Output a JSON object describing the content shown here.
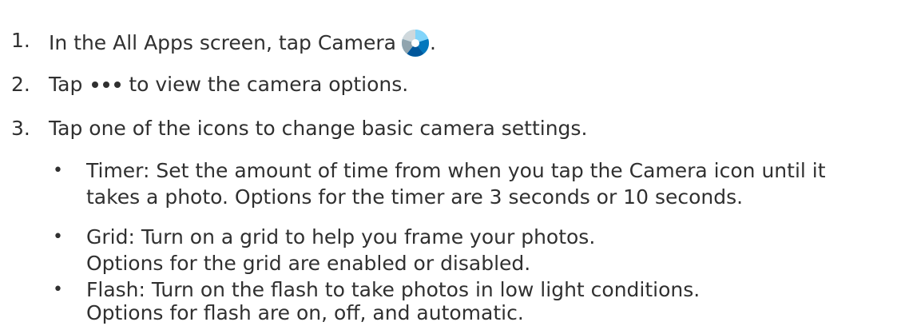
{
  "steps": [
    {
      "number": "1.",
      "text_before": "In the All Apps screen, tap Camera",
      "icon": "camera-app-icon",
      "text_after": "."
    },
    {
      "number": "2.",
      "text_before": "Tap",
      "icon": "more-options-icon",
      "text_after": "to view the camera options."
    },
    {
      "number": "3.",
      "text": "Tap one of the icons to change basic camera settings."
    }
  ],
  "bullets": [
    {
      "symbol": "•",
      "lines": [
        "Timer: Set the amount of time from when you tap the Camera icon until it",
        "takes a photo. Options for the timer are 3 seconds or 10 seconds."
      ]
    },
    {
      "symbol": "•",
      "lines": [
        "Grid: Turn on a grid to help you frame your photos.",
        "Options for the grid are enabled or disabled."
      ]
    },
    {
      "symbol": "•",
      "lines": [
        "Flash: Turn on the flash to take photos in low light conditions.",
        "Options for flash are on, off, and automatic."
      ]
    }
  ],
  "colors": {
    "text": "#303030",
    "icon_light_blue": "#4fc3f7",
    "icon_dark_blue": "#0277bd",
    "icon_mid_blue": "#29b6f6",
    "icon_gray": "#90a4ae"
  }
}
